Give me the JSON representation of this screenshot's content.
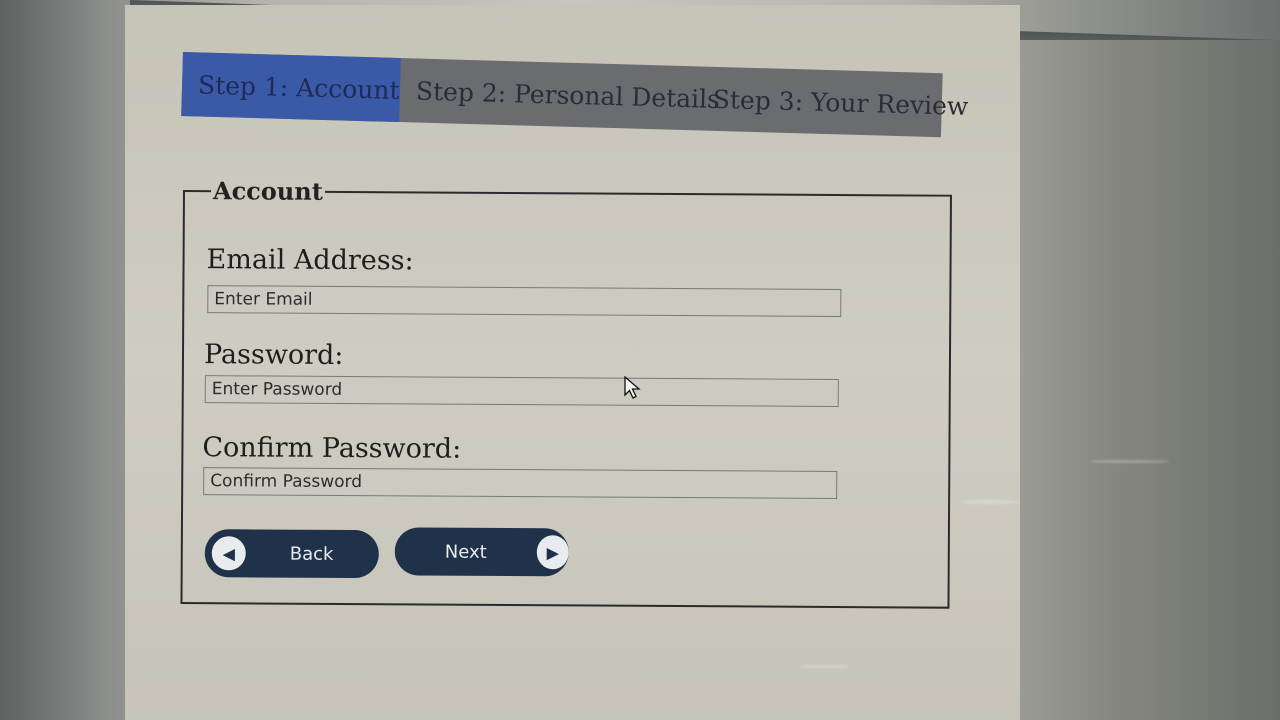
{
  "tabs": [
    {
      "label": "Step 1: Account",
      "active": true
    },
    {
      "label": "Step 2: Personal Details",
      "active": false
    },
    {
      "label": "Step 3: Your Review",
      "active": false
    }
  ],
  "form": {
    "legend": "Account",
    "email": {
      "label": "Email Address:",
      "placeholder": "Enter Email",
      "value": ""
    },
    "password": {
      "label": "Password:",
      "placeholder": "Enter Password",
      "value": ""
    },
    "confirm": {
      "label": "Confirm Password:",
      "placeholder": "Confirm Password",
      "value": ""
    }
  },
  "buttons": {
    "back_label": "Back",
    "back_icon": "arrow-left-icon",
    "next_label": "Next",
    "next_icon": "arrow-right-icon"
  },
  "colors": {
    "active_tab": "#3a5aa8",
    "tab_bar": "#6a6c70",
    "button": "#203249"
  }
}
